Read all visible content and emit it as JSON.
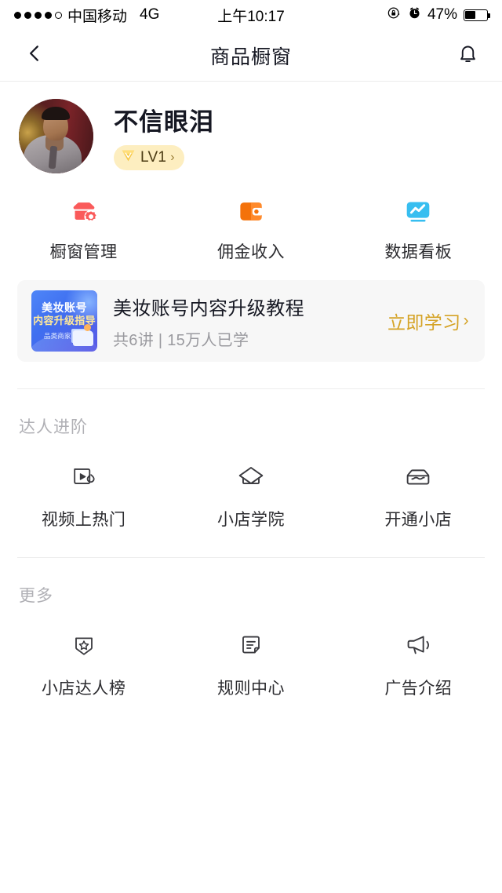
{
  "status_bar": {
    "signal_dots_filled": 4,
    "signal_dots_total": 5,
    "carrier": "中国移动",
    "network": "4G",
    "time": "上午10:17",
    "rotation_lock_icon": "rotation-lock-icon",
    "alarm_icon": "alarm-clock-icon",
    "battery_percent_label": "47%",
    "battery_level": 47
  },
  "nav": {
    "back_icon": "chevron-left-icon",
    "title": "商品橱窗",
    "bell_icon": "bell-icon"
  },
  "profile": {
    "name": "不信眼泪",
    "level_label": "LV1",
    "level_chevron": "›",
    "diamond_icon": "diamond-icon",
    "avatar_alt": "user-avatar"
  },
  "quick_actions": [
    {
      "label": "橱窗管理",
      "icon": "shop-settings-icon",
      "color": "#FA5A5A"
    },
    {
      "label": "佣金收入",
      "icon": "wallet-icon",
      "color": "#F4720B"
    },
    {
      "label": "数据看板",
      "icon": "data-board-icon",
      "color": "#37BEF0"
    }
  ],
  "banner": {
    "thumb_line1": "美妆账号",
    "thumb_line2": "内容升级指导",
    "thumb_line3": "品类商家必看",
    "title": "美妆账号内容升级教程",
    "subtitle": "共6讲 | 15万人已学",
    "cta_label": "立即学习",
    "cta_chevron": "›",
    "cta_color": "#D5A326"
  },
  "sections": [
    {
      "title": "达人进阶",
      "items": [
        {
          "label": "视频上热门",
          "icon": "video-hot-icon"
        },
        {
          "label": "小店学院",
          "icon": "graduation-cap-icon"
        },
        {
          "label": "开通小店",
          "icon": "store-icon"
        }
      ]
    },
    {
      "title": "更多",
      "items": [
        {
          "label": "小店达人榜",
          "icon": "badge-star-icon"
        },
        {
          "label": "规则中心",
          "icon": "document-rules-icon"
        },
        {
          "label": "广告介绍",
          "icon": "megaphone-icon"
        }
      ]
    }
  ]
}
